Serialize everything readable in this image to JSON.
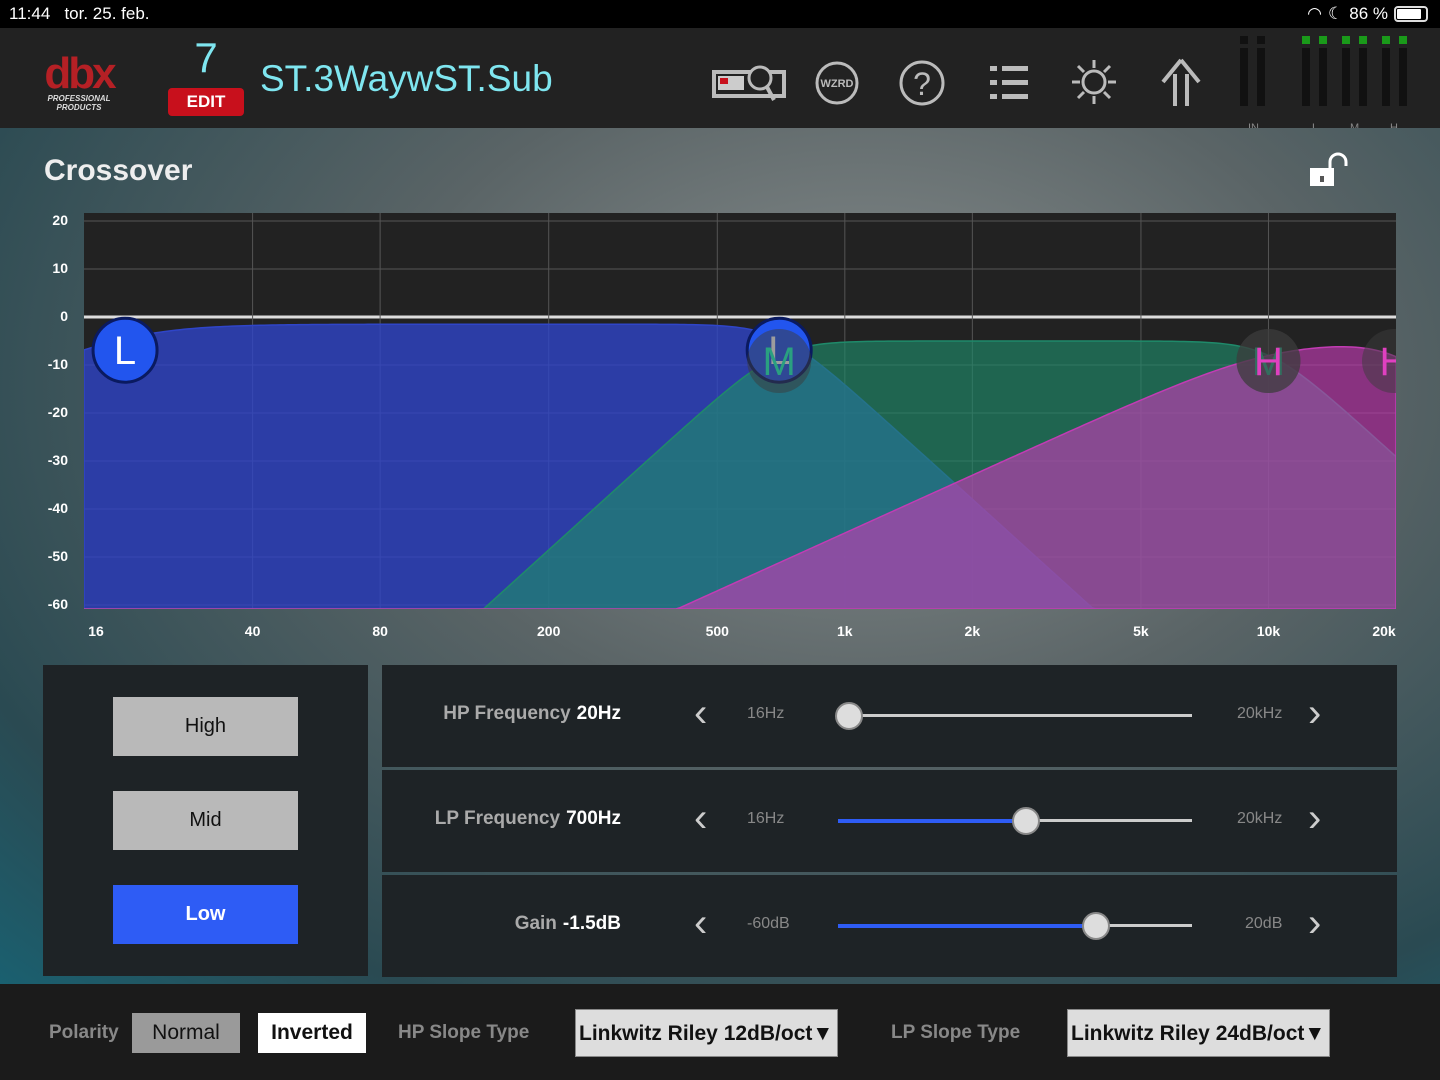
{
  "status": {
    "time": "11:44",
    "date": "tor. 25. feb.",
    "battery": "86 %",
    "battery_level": 0.86
  },
  "header": {
    "logo": "dbx",
    "logo_sub": "PROFESSIONAL PRODUCTS",
    "preset_number": "7",
    "edit_label": "EDIT",
    "preset_name": "ST.3WaywST.Sub",
    "wizard_label": "WZRD",
    "help_label": "?",
    "meter_labels": [
      "IN",
      "L",
      "M",
      "H"
    ]
  },
  "page": {
    "title": "Crossover"
  },
  "graph": {
    "y_ticks": [
      "20",
      "10",
      "0",
      "-10",
      "-20",
      "-30",
      "-40",
      "-50",
      "-60"
    ],
    "y_values": [
      20,
      10,
      0,
      -10,
      -20,
      -30,
      -40,
      -50,
      -60
    ],
    "x_ticks": [
      "16",
      "40",
      "80",
      "200",
      "500",
      "1k",
      "2k",
      "5k",
      "10k",
      "20k"
    ],
    "x_values": [
      16,
      40,
      80,
      200,
      500,
      1000,
      2000,
      5000,
      10000,
      20000
    ],
    "bands": [
      {
        "name": "Low",
        "hp": 20,
        "hp_order": 2,
        "lp": 700,
        "lp_order": 4,
        "gain": -1.5,
        "color": "#2f45c8",
        "handle": "L"
      },
      {
        "name": "Mid",
        "hp": 700,
        "hp_order": 4,
        "lp": 10000,
        "lp_order": 4,
        "gain": -5,
        "color": "#1f8a6a",
        "handle": "M"
      },
      {
        "name": "High",
        "hp": 10000,
        "hp_order": 2,
        "lp": 20000,
        "lp_order": 4,
        "gain": -5,
        "color": "#c23cb4",
        "handle": "H"
      }
    ]
  },
  "band_buttons": [
    {
      "label": "High",
      "active": false
    },
    {
      "label": "Mid",
      "active": false
    },
    {
      "label": "Low",
      "active": true
    }
  ],
  "params": [
    {
      "label": "HP Frequency",
      "value": "20Hz",
      "min": "16Hz",
      "max": "20kHz",
      "position": 0.03
    },
    {
      "label": "LP Frequency",
      "value": "700Hz",
      "min": "16Hz",
      "max": "20kHz",
      "position": 0.53
    },
    {
      "label": "Gain",
      "value": "-1.5dB",
      "min": "-60dB",
      "max": "20dB",
      "position": 0.73
    }
  ],
  "footer": {
    "polarity_label": "Polarity",
    "normal": "Normal",
    "inverted": "Inverted",
    "hp_slope_label": "HP Slope Type",
    "hp_slope": "Linkwitz Riley 12dB/oct",
    "lp_slope_label": "LP Slope Type",
    "lp_slope": "Linkwitz Riley 24dB/oct"
  }
}
